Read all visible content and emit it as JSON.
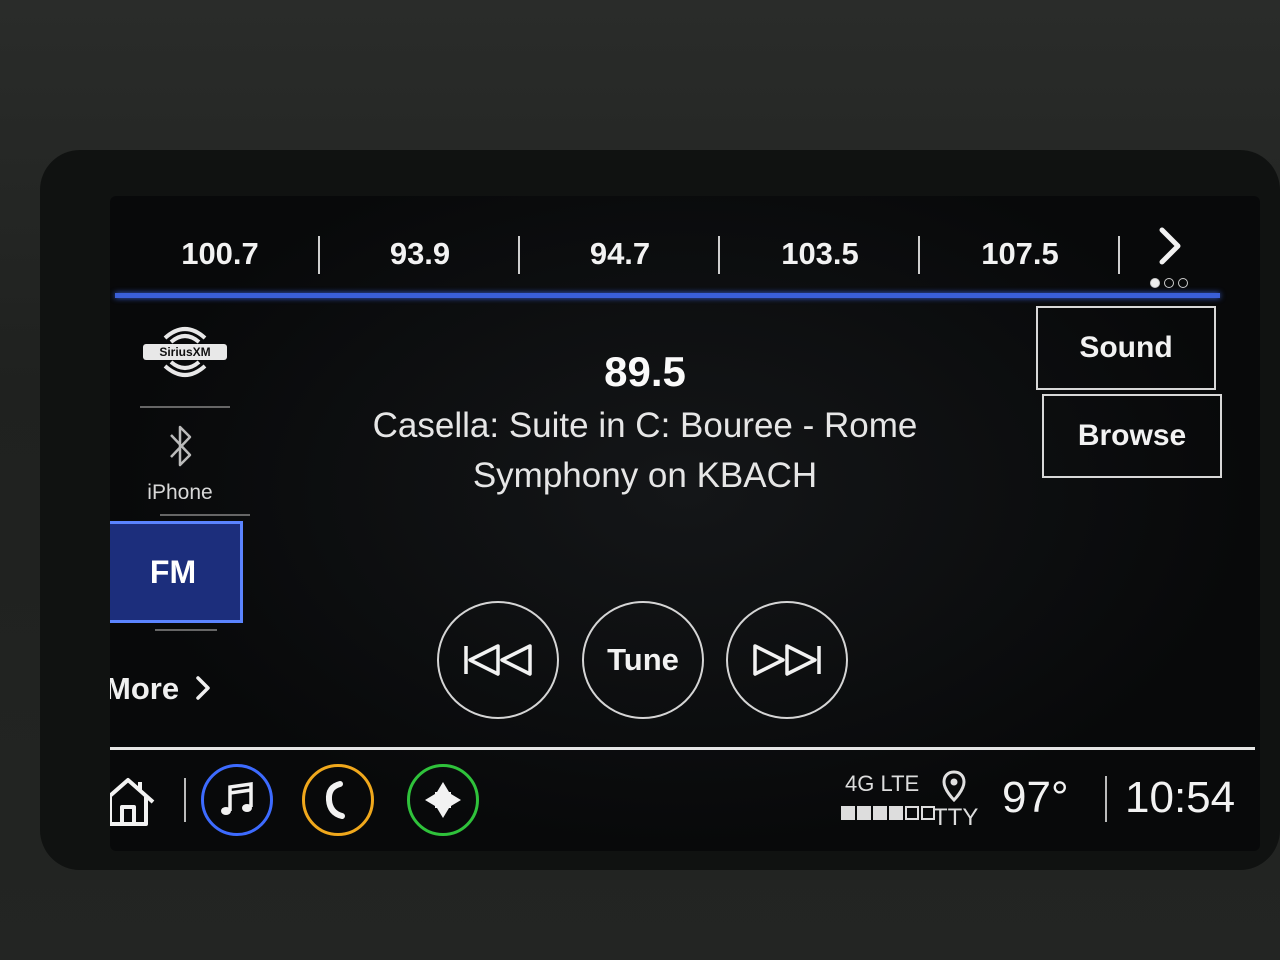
{
  "presets": [
    "100.7",
    "93.9",
    "94.7",
    "103.5",
    "107.5"
  ],
  "preset_page": {
    "current": 1,
    "total": 3
  },
  "sources": {
    "sirius_logo_text": "SiriusXM",
    "bluetooth_device": "iPhone",
    "fm_label": "FM",
    "more_label": "More"
  },
  "now_playing": {
    "frequency": "89.5",
    "line1": "Casella: Suite in C: Bouree - Rome",
    "line2": "Symphony on KBACH"
  },
  "side_buttons": {
    "sound": "Sound",
    "browse": "Browse"
  },
  "transport": {
    "tune_label": "Tune"
  },
  "status": {
    "network": "4G LTE",
    "signal_bars": 4,
    "signal_bars_total": 6,
    "tty": "TTY",
    "temperature": "97°",
    "time": "10:54"
  },
  "icons": {
    "home": "home-icon",
    "audio": "music-note-icon",
    "phone": "phone-icon",
    "nav": "compass-arrows-icon",
    "next": "chevron-right-icon"
  },
  "colors": {
    "accent_blue": "#3a5fd8",
    "fm_selected_bg": "#1c2e7c",
    "audio_ring": "#3d6bff",
    "phone_ring": "#f0a81c",
    "nav_ring": "#2fc23b"
  }
}
